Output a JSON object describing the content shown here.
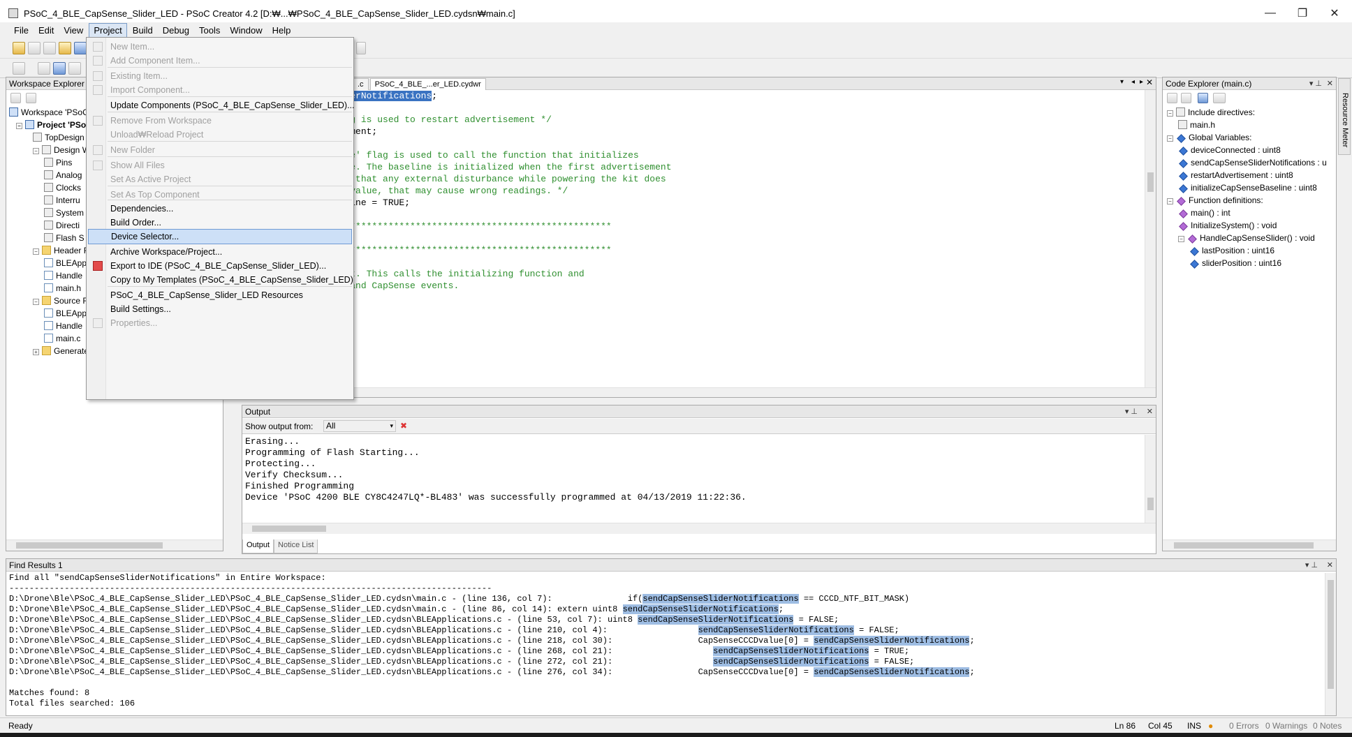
{
  "window": {
    "title": "PSoC_4_BLE_CapSense_Slider_LED - PSoC Creator 4.2  [D:₩...₩PSoC_4_BLE_CapSense_Slider_LED.cydsn₩main.c]",
    "minimize": "—",
    "maximize": "❐",
    "close": "✕"
  },
  "menubar": [
    {
      "label": "File"
    },
    {
      "label": "Edit"
    },
    {
      "label": "View"
    },
    {
      "label": "Project"
    },
    {
      "label": "Build"
    },
    {
      "label": "Debug"
    },
    {
      "label": "Tools"
    },
    {
      "label": "Window"
    },
    {
      "label": "Help"
    }
  ],
  "project_menu": [
    {
      "label": "New Item...",
      "disabled": true
    },
    {
      "label": "Add Component Item...",
      "disabled": true
    },
    {
      "label": "Existing Item...",
      "disabled": true
    },
    {
      "label": "Import Component...",
      "disabled": true
    },
    {
      "label": "Update Components (PSoC_4_BLE_CapSense_Slider_LED)...",
      "disabled": false
    },
    {
      "label": "Remove From Workspace",
      "disabled": true
    },
    {
      "label": "Unload₩Reload Project",
      "disabled": true
    },
    {
      "label": "New Folder",
      "disabled": true
    },
    {
      "label": "Show All Files",
      "disabled": true
    },
    {
      "label": "Set As Active Project",
      "disabled": true
    },
    {
      "label": "Set As Top Component",
      "disabled": true
    },
    {
      "label": "Dependencies...",
      "disabled": false
    },
    {
      "label": "Build Order...",
      "disabled": false
    },
    {
      "label": "Device Selector...",
      "disabled": false,
      "selected": true
    },
    {
      "label": "Archive Workspace/Project...",
      "disabled": false
    },
    {
      "label": "Export to IDE (PSoC_4_BLE_CapSense_Slider_LED)...",
      "disabled": false
    },
    {
      "label": "Copy to My Templates (PSoC_4_BLE_CapSense_Slider_LED)",
      "disabled": false
    },
    {
      "label": "PSoC_4_BLE_CapSense_Slider_LED Resources",
      "disabled": false
    },
    {
      "label": "Build Settings...",
      "disabled": false
    },
    {
      "label": "Properties...",
      "disabled": true
    }
  ],
  "workspace_explorer": {
    "title": "Workspace Explorer (",
    "items": [
      {
        "label": "Workspace 'PSoC",
        "icon": "workspace-icon"
      },
      {
        "label": "Project  'PSoC",
        "icon": "project-icon",
        "bold": true
      },
      {
        "label": "TopDesign",
        "icon": "schematic-icon"
      },
      {
        "label": "Design Wi",
        "icon": "design-wide-icon"
      },
      {
        "label": "Pins",
        "icon": "pins-icon"
      },
      {
        "label": "Analog",
        "icon": "analog-icon"
      },
      {
        "label": "Clocks",
        "icon": "clock-icon"
      },
      {
        "label": "Interru",
        "icon": "interrupt-icon"
      },
      {
        "label": "System",
        "icon": "system-icon"
      },
      {
        "label": "Directi",
        "icon": "directives-icon"
      },
      {
        "label": "Flash S",
        "icon": "flash-icon"
      },
      {
        "label": "Header Fil",
        "icon": "folder-icon"
      },
      {
        "label": "BLEApp",
        "icon": "header-file-icon"
      },
      {
        "label": "Handle",
        "icon": "header-file-icon"
      },
      {
        "label": "main.h",
        "icon": "header-file-icon"
      },
      {
        "label": "Source Fil",
        "icon": "folder-icon"
      },
      {
        "label": "BLEApp",
        "icon": "c-file-icon"
      },
      {
        "label": "Handle",
        "icon": "c-file-icon"
      },
      {
        "label": "main.c",
        "icon": "c-file-icon"
      },
      {
        "label": "Generated",
        "icon": "folder-icon"
      }
    ]
  },
  "editor": {
    "tabs": [
      {
        "label": ".c"
      },
      {
        "label": "PSoC_4_BLE_...er_LED.cydwr"
      }
    ],
    "lines": [
      {
        "pre": "t8 ",
        "hl": "sendCapSenseSliderNotifications",
        "post": ";",
        "type": "code"
      },
      {
        "pre": "",
        "hl": "",
        "post": "",
        "type": "blank"
      },
      {
        "pre": "tAdvertisement' flag is used to restart advertisement */",
        "hl": "",
        "post": "",
        "type": "comment"
      },
      {
        "pre": "t8 restartAdvertisement;",
        "hl": "",
        "post": "",
        "type": "code"
      },
      {
        "pre": "",
        "hl": "",
        "post": "",
        "type": "blank"
      },
      {
        "pre": "lizeCapSenseBaseline' flag is used to call the function that initializes",
        "hl": "",
        "post": "",
        "type": "comment"
      },
      {
        "pre": "ense baselines, once. The baseline is initialized when the first advertisement",
        "hl": "",
        "post": "",
        "type": "comment"
      },
      {
        "pre": "ed. This is done so that any external disturbance while powering the kit does",
        "hl": "",
        "post": "",
        "type": "comment"
      },
      {
        "pre": "uence the baseline value, that may cause wrong readings. */",
        "hl": "",
        "post": "",
        "type": "comment"
      },
      {
        "pre": "ializeCapSenseBaseline = TRUE;",
        "hl": "",
        "post": "",
        "type": "code"
      },
      {
        "pre": "",
        "hl": "",
        "post": "",
        "type": "blank"
      },
      {
        "pre": "*******************************************************************",
        "hl": "",
        "post": "",
        "type": "comment"
      },
      {
        "pre": " Name: main",
        "hl": "",
        "post": "",
        "type": "comment"
      },
      {
        "pre": "*******************************************************************",
        "hl": "",
        "post": "",
        "type": "comment"
      },
      {
        "pre": "",
        "hl": "",
        "post": "",
        "type": "blank"
      },
      {
        "pre": "ystem entrance point. This calls the initializing function and",
        "hl": "",
        "post": "",
        "type": "comment"
      },
      {
        "pre": "usly processes BLE and CapSense events.",
        "hl": "",
        "post": "",
        "type": "comment"
      },
      {
        "pre": "",
        "hl": "",
        "post": "",
        "type": "blank"
      },
      {
        "pre": "rs:",
        "hl": "",
        "post": "",
        "type": "comment"
      }
    ]
  },
  "output": {
    "title": "Output",
    "show_from_label": "Show output from:",
    "show_from_value": "All",
    "lines": [
      "Erasing...",
      "Programming of Flash Starting...",
      "Protecting...",
      "Verify Checksum...",
      "Finished Programming",
      "Device 'PSoC 4200 BLE CY8C4247LQ*-BL483' was successfully programmed at 04/13/2019 11:22:36."
    ],
    "tabs": [
      {
        "label": "Output"
      },
      {
        "label": "Notice List"
      }
    ]
  },
  "code_explorer": {
    "title": "Code Explorer (main.c)",
    "side_tab": "Resource Meter",
    "items": [
      {
        "label": "Include directives:",
        "level": 0,
        "icon": "include-icon"
      },
      {
        "label": "main.h",
        "level": 1,
        "icon": "include-file-icon"
      },
      {
        "label": "Global Variables:",
        "level": 0,
        "icon": "variable-group-icon"
      },
      {
        "label": "deviceConnected : uint8",
        "level": 1,
        "icon": "variable-icon"
      },
      {
        "label": "sendCapSenseSliderNotifications : u",
        "level": 1,
        "icon": "variable-icon"
      },
      {
        "label": "restartAdvertisement : uint8",
        "level": 1,
        "icon": "variable-icon"
      },
      {
        "label": "initializeCapSenseBaseline : uint8",
        "level": 1,
        "icon": "variable-icon"
      },
      {
        "label": "Function definitions:",
        "level": 0,
        "icon": "function-group-icon"
      },
      {
        "label": "main() : int",
        "level": 1,
        "icon": "function-icon"
      },
      {
        "label": "InitializeSystem() : void",
        "level": 1,
        "icon": "function-icon"
      },
      {
        "label": "HandleCapSenseSlider() : void",
        "level": 1,
        "icon": "function-icon"
      },
      {
        "label": "lastPosition : uint16",
        "level": 2,
        "icon": "variable-icon"
      },
      {
        "label": "sliderPosition : uint16",
        "level": 2,
        "icon": "variable-icon"
      }
    ]
  },
  "find_results": {
    "title": "Find Results 1",
    "header": "Find all \"sendCapSenseSliderNotifications\" in Entire Workspace:",
    "separator": "------------------------------------------------------------------------------------------------",
    "results": [
      {
        "loc": "D:\\Drone\\Ble\\PSoC_4_BLE_CapSense_Slider_LED\\PSoC_4_BLE_CapSense_Slider_LED.cydsn\\main.c - (line 136, col 7):",
        "pad": "               ",
        "pre": "if(",
        "hl": "sendCapSenseSliderNotifications",
        "post": " == CCCD_NTF_BIT_MASK)"
      },
      {
        "loc": "D:\\Drone\\Ble\\PSoC_4_BLE_CapSense_Slider_LED\\PSoC_4_BLE_CapSense_Slider_LED.cydsn\\main.c - (line 86, col 14):",
        "pad": " ",
        "pre": "extern uint8 ",
        "hl": "sendCapSenseSliderNotifications",
        "post": ";"
      },
      {
        "loc": "D:\\Drone\\Ble\\PSoC_4_BLE_CapSense_Slider_LED\\PSoC_4_BLE_CapSense_Slider_LED.cydsn\\BLEApplications.c - (line 53, col 7):",
        "pad": " ",
        "pre": "uint8 ",
        "hl": "sendCapSenseSliderNotifications",
        "post": " = FALSE;"
      },
      {
        "loc": "D:\\Drone\\Ble\\PSoC_4_BLE_CapSense_Slider_LED\\PSoC_4_BLE_CapSense_Slider_LED.cydsn\\BLEApplications.c - (line 210, col 4):",
        "pad": "                  ",
        "pre": "",
        "hl": "sendCapSenseSliderNotifications",
        "post": " = FALSE;"
      },
      {
        "loc": "D:\\Drone\\Ble\\PSoC_4_BLE_CapSense_Slider_LED\\PSoC_4_BLE_CapSense_Slider_LED.cydsn\\BLEApplications.c - (line 218, col 30):",
        "pad": "                 ",
        "pre": "CapSenseCCCDvalue[0] = ",
        "hl": "sendCapSenseSliderNotifications",
        "post": ";"
      },
      {
        "loc": "D:\\Drone\\Ble\\PSoC_4_BLE_CapSense_Slider_LED\\PSoC_4_BLE_CapSense_Slider_LED.cydsn\\BLEApplications.c - (line 268, col 21):",
        "pad": "                    ",
        "pre": "",
        "hl": "sendCapSenseSliderNotifications",
        "post": " = TRUE;"
      },
      {
        "loc": "D:\\Drone\\Ble\\PSoC_4_BLE_CapSense_Slider_LED\\PSoC_4_BLE_CapSense_Slider_LED.cydsn\\BLEApplications.c - (line 272, col 21):",
        "pad": "                    ",
        "pre": "",
        "hl": "sendCapSenseSliderNotifications",
        "post": " = FALSE;"
      },
      {
        "loc": "D:\\Drone\\Ble\\PSoC_4_BLE_CapSense_Slider_LED\\PSoC_4_BLE_CapSense_Slider_LED.cydsn\\BLEApplications.c - (line 276, col 34):",
        "pad": "                 ",
        "pre": "CapSenseCCCDvalue[0] = ",
        "hl": "sendCapSenseSliderNotifications",
        "post": ";"
      }
    ],
    "matches": "Matches found: 8",
    "total_files": "Total files searched: 106"
  },
  "statusbar": {
    "ready": "Ready",
    "ln": "Ln 86",
    "col": "Col 45",
    "ins": "INS",
    "errors": "0 Errors",
    "warnings": "0 Warnings",
    "notes": "0 Notes"
  },
  "colors": {
    "selection": "#3a73c2",
    "match_highlight": "#9ebde3",
    "comment": "#2f8f2f",
    "menu_selected": "#cde0f7"
  }
}
